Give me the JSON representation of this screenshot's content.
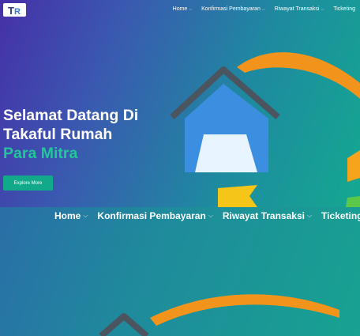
{
  "topnav": {
    "items": [
      {
        "label": "Home"
      },
      {
        "label": "Konfirmasi Pembayaran"
      },
      {
        "label": "Riwayat Transaksi"
      },
      {
        "label": "Ticketing"
      }
    ]
  },
  "hero": {
    "line1": "Selamat Datang Di",
    "line2": "Takaful Rumah",
    "line3": "Para Mitra",
    "cta": "Explore More"
  },
  "nav2": {
    "items": [
      {
        "label": "Home"
      },
      {
        "label": "Konfirmasi Pembayaran"
      },
      {
        "label": "Riwayat Transaksi"
      },
      {
        "label": "Ticketing"
      }
    ]
  },
  "colors": {
    "accent": "#21c79a",
    "button": "#12a98a",
    "orange": "#f2941c",
    "house_blue": "#3b8ee0",
    "roof": "#4a5560",
    "flag": "#f5c518"
  },
  "icons": {
    "logo": "tr-logo",
    "chevron": "chevron-down-icon"
  }
}
